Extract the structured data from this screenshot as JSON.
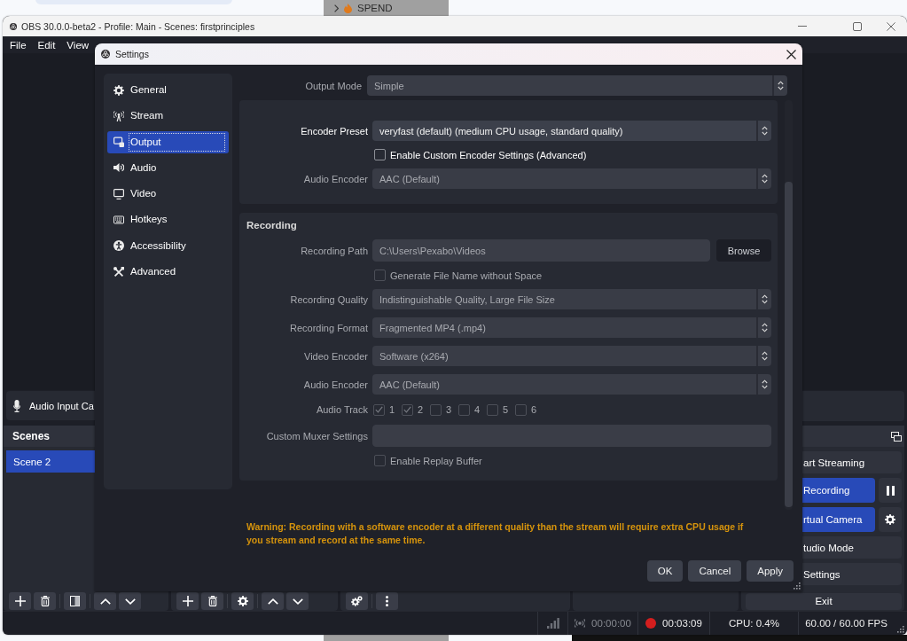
{
  "desktop": {
    "panel_label": "SPEND"
  },
  "window": {
    "title": "OBS 30.0.0-beta2 - Profile: Main - Scenes: firstprinciples"
  },
  "menu": [
    "File",
    "Edit",
    "View"
  ],
  "audio_mixer": {
    "sources": [
      {
        "name": "Audio Input Ca"
      }
    ]
  },
  "scenes": {
    "title": "Scenes",
    "items": [
      {
        "name": "Scene 2",
        "selected": true
      }
    ]
  },
  "controls": {
    "buttons": [
      {
        "label": "art Streaming",
        "active": false,
        "kind": "plain"
      },
      {
        "label": "Recording",
        "active": true,
        "kind": "split"
      },
      {
        "label": "rtual Camera",
        "active": true,
        "kind": "split"
      },
      {
        "label": "tudio Mode",
        "active": false,
        "kind": "plain"
      },
      {
        "label": "Settings",
        "active": false,
        "kind": "plain"
      }
    ],
    "exit": "Exit"
  },
  "status_bar": {
    "streaming": {
      "time": "00:00:00",
      "active": false
    },
    "recording": {
      "time": "00:03:09",
      "active": true
    },
    "cpu": "CPU: 0.4%",
    "fps": "60.00 / 60.00 FPS"
  },
  "settings": {
    "title": "Settings",
    "sidebar": [
      {
        "label": "General",
        "selected": false
      },
      {
        "label": "Stream",
        "selected": false
      },
      {
        "label": "Output",
        "selected": true
      },
      {
        "label": "Audio",
        "selected": false
      },
      {
        "label": "Video",
        "selected": false
      },
      {
        "label": "Hotkeys",
        "selected": false
      },
      {
        "label": "Accessibility",
        "selected": false
      },
      {
        "label": "Advanced",
        "selected": false
      }
    ],
    "output_mode": {
      "label": "Output Mode",
      "value": "Simple",
      "disabled": true
    },
    "groups": [
      {
        "rows": [
          {
            "kind": "select",
            "label": "Encoder Preset",
            "value": "veryfast (default) (medium CPU usage, standard quality)",
            "disabled": false
          },
          {
            "kind": "checkbox",
            "label": "Enable Custom Encoder Settings (Advanced)",
            "checked": false,
            "disabled": false
          },
          {
            "kind": "select",
            "label": "Audio Encoder",
            "value": "AAC (Default)",
            "disabled": true
          }
        ]
      },
      {
        "title": "Recording",
        "rows": [
          {
            "kind": "path",
            "label": "Recording Path",
            "value": "C:\\Users\\Pexabo\\Videos",
            "button": "Browse",
            "disabled": true
          },
          {
            "kind": "checkbox",
            "label": "Generate File Name without Space",
            "checked": false,
            "disabled": true
          },
          {
            "kind": "select",
            "label": "Recording Quality",
            "value": "Indistinguishable Quality, Large File Size",
            "disabled": true
          },
          {
            "kind": "select",
            "label": "Recording Format",
            "value": "Fragmented MP4 (.mp4)",
            "disabled": true
          },
          {
            "kind": "select",
            "label": "Video Encoder",
            "value": "Software (x264)",
            "disabled": true
          },
          {
            "kind": "select",
            "label": "Audio Encoder",
            "value": "AAC (Default)",
            "disabled": true
          },
          {
            "kind": "tracks",
            "label": "Audio Track",
            "disabled": true,
            "tracks": [
              {
                "label": "1",
                "checked": true
              },
              {
                "label": "2",
                "checked": true
              },
              {
                "label": "3",
                "checked": false
              },
              {
                "label": "4",
                "checked": false
              },
              {
                "label": "5",
                "checked": false
              },
              {
                "label": "6",
                "checked": false
              }
            ]
          },
          {
            "kind": "text",
            "label": "Custom Muxer Settings",
            "disabled": true
          },
          {
            "kind": "checkbox",
            "label": "Enable Replay Buffer",
            "checked": false,
            "disabled": true
          }
        ]
      }
    ],
    "warning": "Warning: Recording with a software encoder at a different quality than the stream will require extra CPU usage if you stream and record at the same time.",
    "buttons": [
      "OK",
      "Cancel",
      "Apply"
    ]
  }
}
